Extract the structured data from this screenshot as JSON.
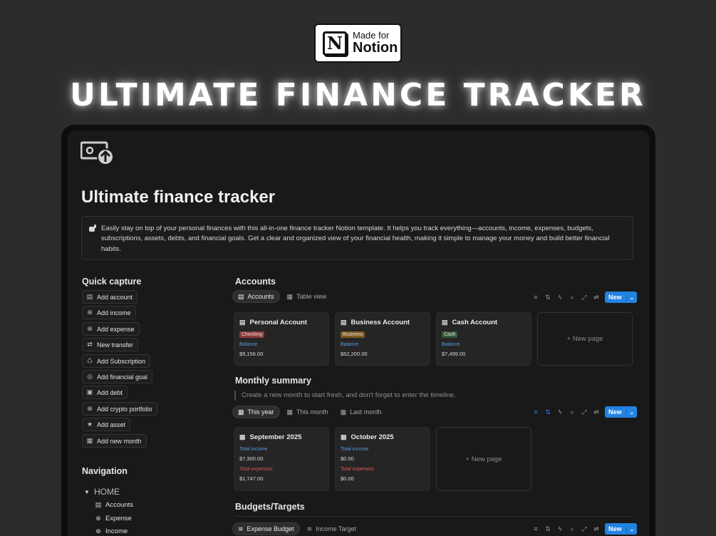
{
  "badge": {
    "logo_letter": "N",
    "line1": "Made for",
    "line2": "Notion"
  },
  "hero_title": "ULTIMATE FINANCE TRACKER",
  "page": {
    "icon": "money-refresh-icon",
    "title": "Ultimate finance tracker",
    "callout_icon": "hand-icon",
    "callout_text": "Easily stay on top of your personal finances with this all-in-one finance tracker Notion template. It helps you track everything—accounts, income, expenses, budgets, subscriptions, assets, debts, and financial goals. Get a clear and organized view of your financial health, making it simple to manage your money and build better financial habits."
  },
  "quick_capture": {
    "heading": "Quick capture",
    "items": [
      {
        "label": "Add account",
        "icon": "wallet-icon"
      },
      {
        "label": "Add income",
        "icon": "arrow-down-circle-icon"
      },
      {
        "label": "Add expense",
        "icon": "arrow-up-circle-icon"
      },
      {
        "label": "New transfer",
        "icon": "transfer-icon"
      },
      {
        "label": "Add Subscription",
        "icon": "subscription-icon"
      },
      {
        "label": "Add financial goal",
        "icon": "target-icon"
      },
      {
        "label": "Add debt",
        "icon": "money-icon"
      },
      {
        "label": "Add crypto portfolio",
        "icon": "crypto-icon"
      },
      {
        "label": "Add asset",
        "icon": "star-icon"
      },
      {
        "label": "Add new month",
        "icon": "calendar-icon"
      }
    ]
  },
  "navigation": {
    "heading": "Navigation",
    "home": "HOME",
    "items": [
      {
        "label": "Accounts",
        "icon": "wallet-icon"
      },
      {
        "label": "Expense",
        "icon": "arrow-up-circle-icon"
      },
      {
        "label": "Income",
        "icon": "arrow-down-circle-icon"
      }
    ]
  },
  "accounts": {
    "heading": "Accounts",
    "tabs": [
      {
        "label": "Accounts",
        "icon": "wallet-icon",
        "active": true
      },
      {
        "label": "Table view",
        "icon": "table-icon",
        "active": false
      }
    ],
    "new_label": "New",
    "cards": [
      {
        "title": "Personal  Account",
        "tag": "Checking",
        "tag_color": "#8a3a3a",
        "field_label": "Balance",
        "value": "$9,156.00"
      },
      {
        "title": "Business Account",
        "tag": "Business",
        "tag_color": "#7a5a1e",
        "field_label": "Balance",
        "value": "$62,200.00"
      },
      {
        "title": "Cash Account",
        "tag": "Cash",
        "tag_color": "#2f5a3a",
        "field_label": "Balance",
        "value": "$7,499.00"
      }
    ],
    "new_page": "+ New page"
  },
  "monthly_summary": {
    "heading": "Monthly summary",
    "hint": "Create a new month to start fresh, and don't forget to enter the timeline.",
    "tabs": [
      {
        "label": "This year",
        "active": true
      },
      {
        "label": "This month",
        "active": false
      },
      {
        "label": "Last month",
        "active": false
      }
    ],
    "new_label": "New",
    "cards": [
      {
        "title": "September 2025",
        "income_label": "Total income",
        "income": "$7,300.00",
        "expense_label": "Total expenses",
        "expense": "$1,747.00"
      },
      {
        "title": "October 2025",
        "income_label": "Total income",
        "income": "$0.00",
        "expense_label": "Total expenses",
        "expense": "$0.00"
      }
    ],
    "new_page": "+ New page"
  },
  "budgets": {
    "heading": "Budgets/Targets",
    "tabs": [
      {
        "label": "Expense Budget",
        "active": true
      },
      {
        "label": "Income Target",
        "active": false
      }
    ],
    "new_label": "New"
  },
  "colors": {
    "accent": "#2383e2",
    "income_label": "#5a9be0",
    "expense_label": "#e05555"
  }
}
